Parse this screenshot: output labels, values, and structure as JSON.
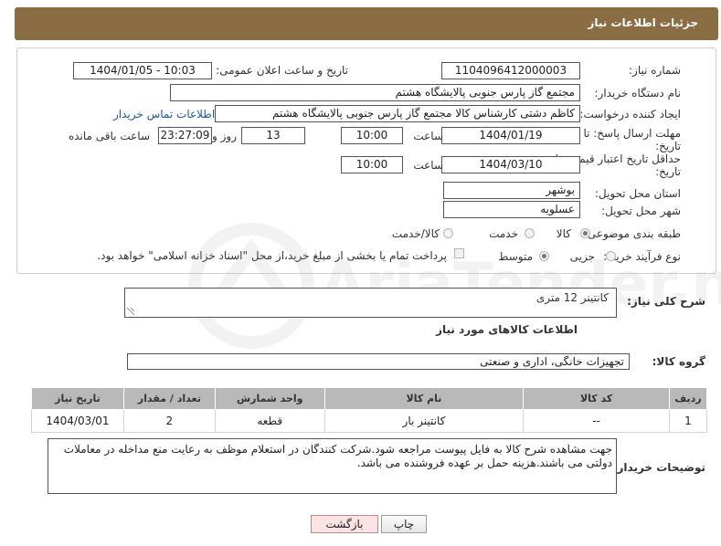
{
  "header": {
    "title": "جزئیات اطلاعات نیاز"
  },
  "form": {
    "need_number": {
      "label": "شماره نیاز:",
      "value": "1104096412000003"
    },
    "announce_datetime": {
      "label": "تاریخ و ساعت اعلان عمومی:",
      "value": "1404/01/05 - 10:03"
    },
    "buyer_org": {
      "label": "نام دستگاه خریدار:",
      "value": "مجتمع گاز پارس جنوبی  پالایشگاه هشتم"
    },
    "requester": {
      "label": "ایجاد کننده درخواست:",
      "value": "کاظم دشتی کارشناس کالا مجتمع گاز پارس جنوبی  پالایشگاه هشتم",
      "contact_link": "اطلاعات تماس خریدار"
    },
    "deadline": {
      "label_line1": "مهلت ارسال پاسخ: تا",
      "label_line2": "تاریخ:",
      "date": "1404/01/19",
      "time_label": "ساعت",
      "time": "10:00",
      "days": "13",
      "days_label": "روز و",
      "remaining": "23:27:09",
      "remaining_label": "ساعت باقی مانده"
    },
    "price_validity": {
      "label_line1": "حداقل تاریخ اعتبار قیمت: تا",
      "label_line2": "تاریخ:",
      "date": "1404/03/10",
      "time_label": "ساعت",
      "time": "10:00"
    },
    "province": {
      "label": "استان محل تحویل:",
      "value": "بوشهر"
    },
    "city": {
      "label": "شهر محل تحویل:",
      "value": "عسلویه"
    },
    "category": {
      "label": "طبقه بندی موضوعی:",
      "options": [
        "کالا",
        "خدمت",
        "کالا/خدمت"
      ],
      "selected": "کالا"
    },
    "purchase_type": {
      "label": "نوع فرآیند خرید :",
      "options": [
        "جزیی",
        "متوسط"
      ],
      "selected": "متوسط",
      "payment_note": "پرداخت تمام یا بخشی از مبلغ خرید،از محل \"اسناد خزانه اسلامی\" خواهد بود."
    }
  },
  "summary": {
    "label": "شرح کلی نیاز:",
    "value": "کانتینر 12 متری"
  },
  "goods_section": {
    "title": "اطلاعات کالاهای مورد نیاز",
    "group_label": "گروه کالا:",
    "group_value": "تجهیزات خانگی، اداری و صنعتی"
  },
  "items_table": {
    "headers": [
      "ردیف",
      "کد کالا",
      "نام کالا",
      "واحد شمارش",
      "تعداد / مقدار",
      "تاریخ نیاز"
    ],
    "rows": [
      [
        "1",
        "--",
        "کانتینر بار",
        "قطعه",
        "2",
        "1404/03/01"
      ]
    ]
  },
  "buyer_notes": {
    "label": "توضیحات خریدار:",
    "value": "جهت مشاهده شرح کالا به فایل پیوست مراجعه شود.شرکت کنندگان در استعلام موظف به رعایت منع مداخله در معاملات دولتی می باشند.هزینه حمل بر عهده فروشنده می باشد."
  },
  "buttons": {
    "print": "چاپ",
    "back": "بازگشت"
  },
  "watermark": {
    "text": "AriaTender.neT",
    "color": "#9a9a9a"
  }
}
